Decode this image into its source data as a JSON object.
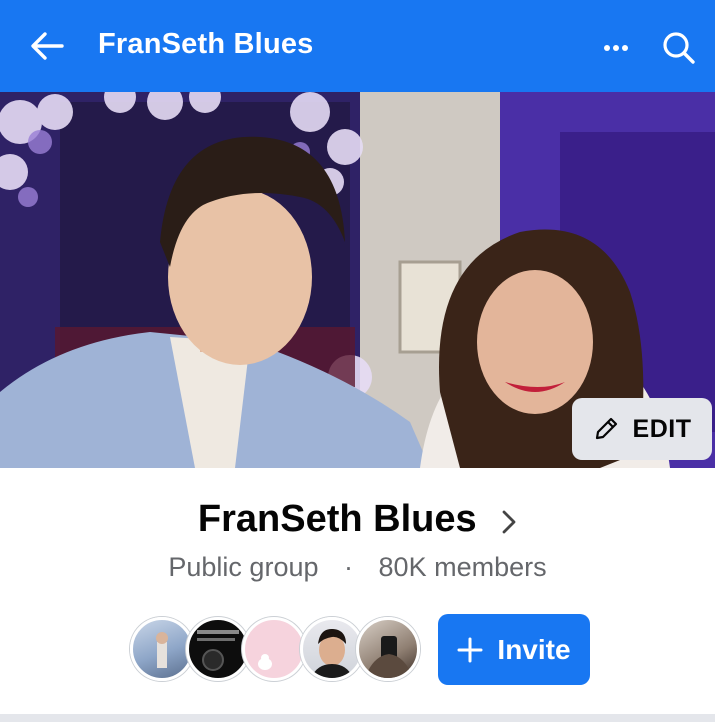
{
  "header": {
    "title": "FranSeth Blues",
    "back_icon": "arrow-left-icon",
    "more_icon": "more-horizontal-icon",
    "search_icon": "search-icon",
    "background_color": "#1877f2"
  },
  "cover": {
    "edit_label": "EDIT",
    "edit_icon": "pencil-icon"
  },
  "group": {
    "name": "FranSeth Blues",
    "privacy": "Public group",
    "separator": "·",
    "members": "80K members"
  },
  "members_preview": {
    "avatars": [
      "member-avatar-1",
      "member-avatar-2",
      "member-avatar-3",
      "member-avatar-4",
      "member-avatar-5"
    ]
  },
  "actions": {
    "invite_label": "Invite",
    "invite_icon": "plus-icon",
    "accent_color": "#1877f2"
  }
}
